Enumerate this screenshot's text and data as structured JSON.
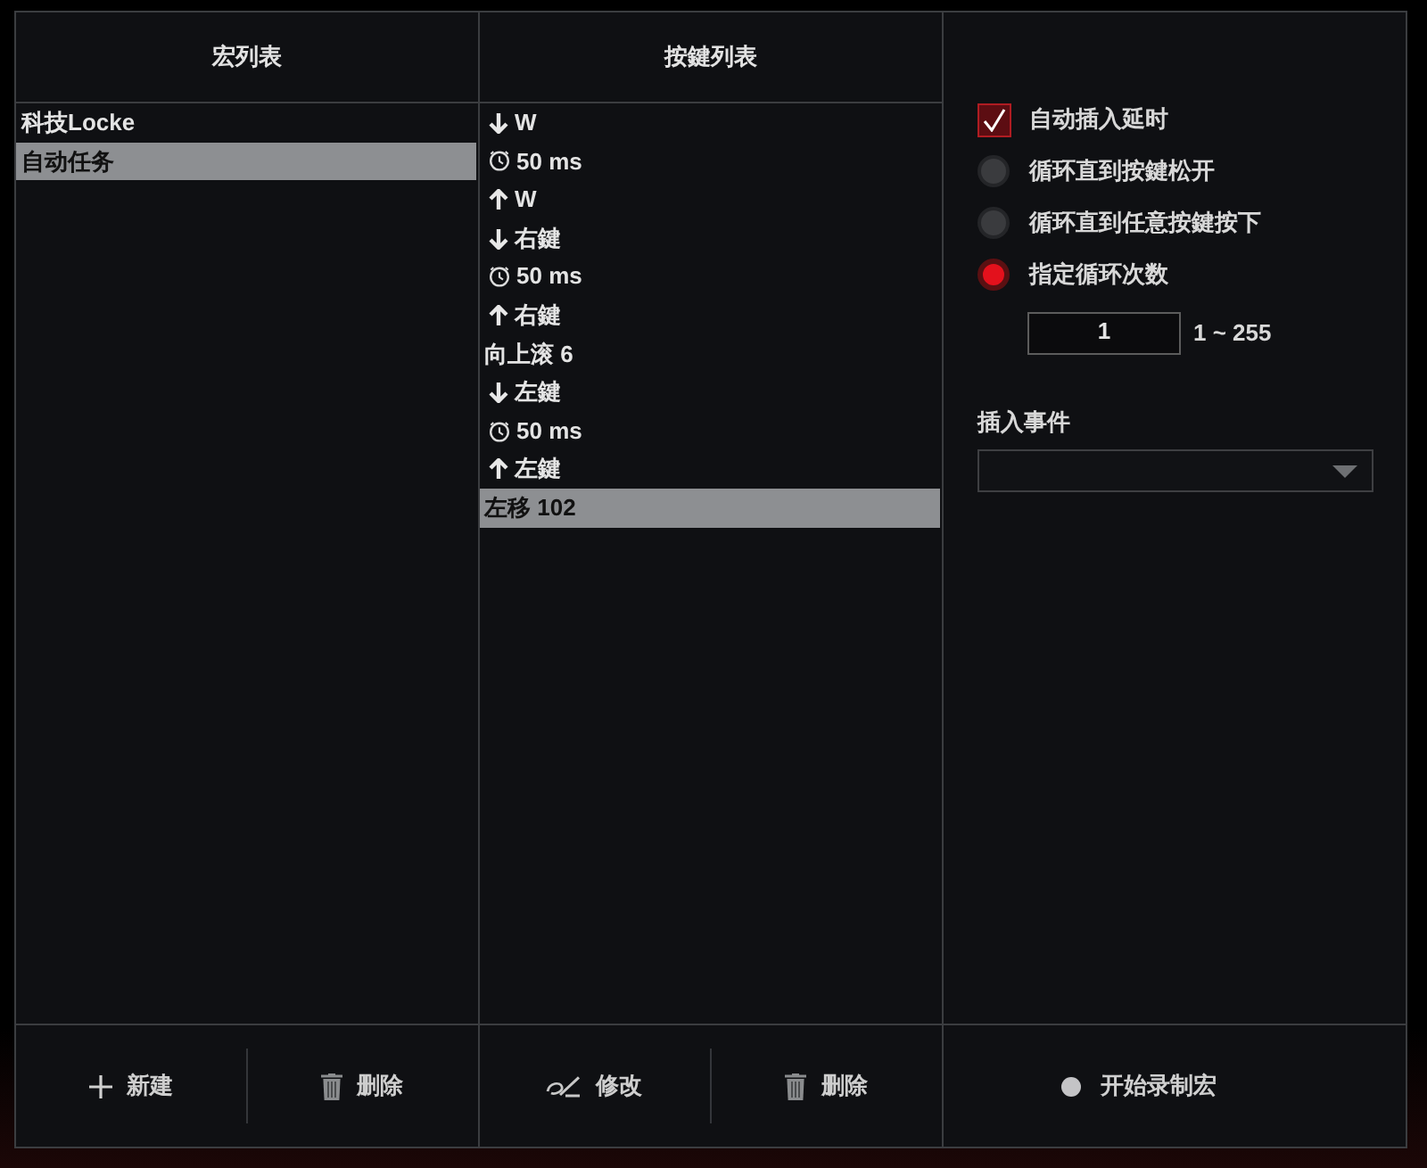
{
  "macro_list": {
    "title": "宏列表",
    "items": [
      {
        "label": "科技Locke",
        "selected": false
      },
      {
        "label": "自动任务",
        "selected": true
      }
    ],
    "buttons": [
      {
        "kind": "add",
        "label": "新建"
      },
      {
        "kind": "delete",
        "label": "删除"
      }
    ]
  },
  "key_list": {
    "title": "按鍵列表",
    "items": [
      {
        "kind": "key_down",
        "label": "W",
        "selected": false
      },
      {
        "kind": "delay",
        "label": "50 ms",
        "selected": false
      },
      {
        "kind": "key_up",
        "label": "W",
        "selected": false
      },
      {
        "kind": "key_down",
        "label": "右鍵",
        "selected": false
      },
      {
        "kind": "delay",
        "label": "50 ms",
        "selected": false
      },
      {
        "kind": "key_up",
        "label": "右鍵",
        "selected": false
      },
      {
        "kind": "action",
        "label": "向上滚 6",
        "selected": false
      },
      {
        "kind": "key_down",
        "label": "左鍵",
        "selected": false
      },
      {
        "kind": "delay",
        "label": "50 ms",
        "selected": false
      },
      {
        "kind": "key_up",
        "label": "左鍵",
        "selected": false
      },
      {
        "kind": "action",
        "label": "左移 102",
        "selected": true
      }
    ],
    "buttons": [
      {
        "kind": "edit",
        "label": "修改"
      },
      {
        "kind": "delete",
        "label": "删除"
      }
    ]
  },
  "options": {
    "auto_delay": {
      "label": "自动插入延时",
      "checked": true
    },
    "loop_modes": [
      {
        "label": "循环直到按鍵松开",
        "selected": false
      },
      {
        "label": "循环直到任意按鍵按下",
        "selected": false
      },
      {
        "label": "指定循环次数",
        "selected": true
      }
    ],
    "loop_count": {
      "value": "1",
      "range": "1 ~ 255"
    },
    "insert_event": {
      "label": "插入事件"
    }
  },
  "record_button": {
    "label": "开始录制宏"
  }
}
